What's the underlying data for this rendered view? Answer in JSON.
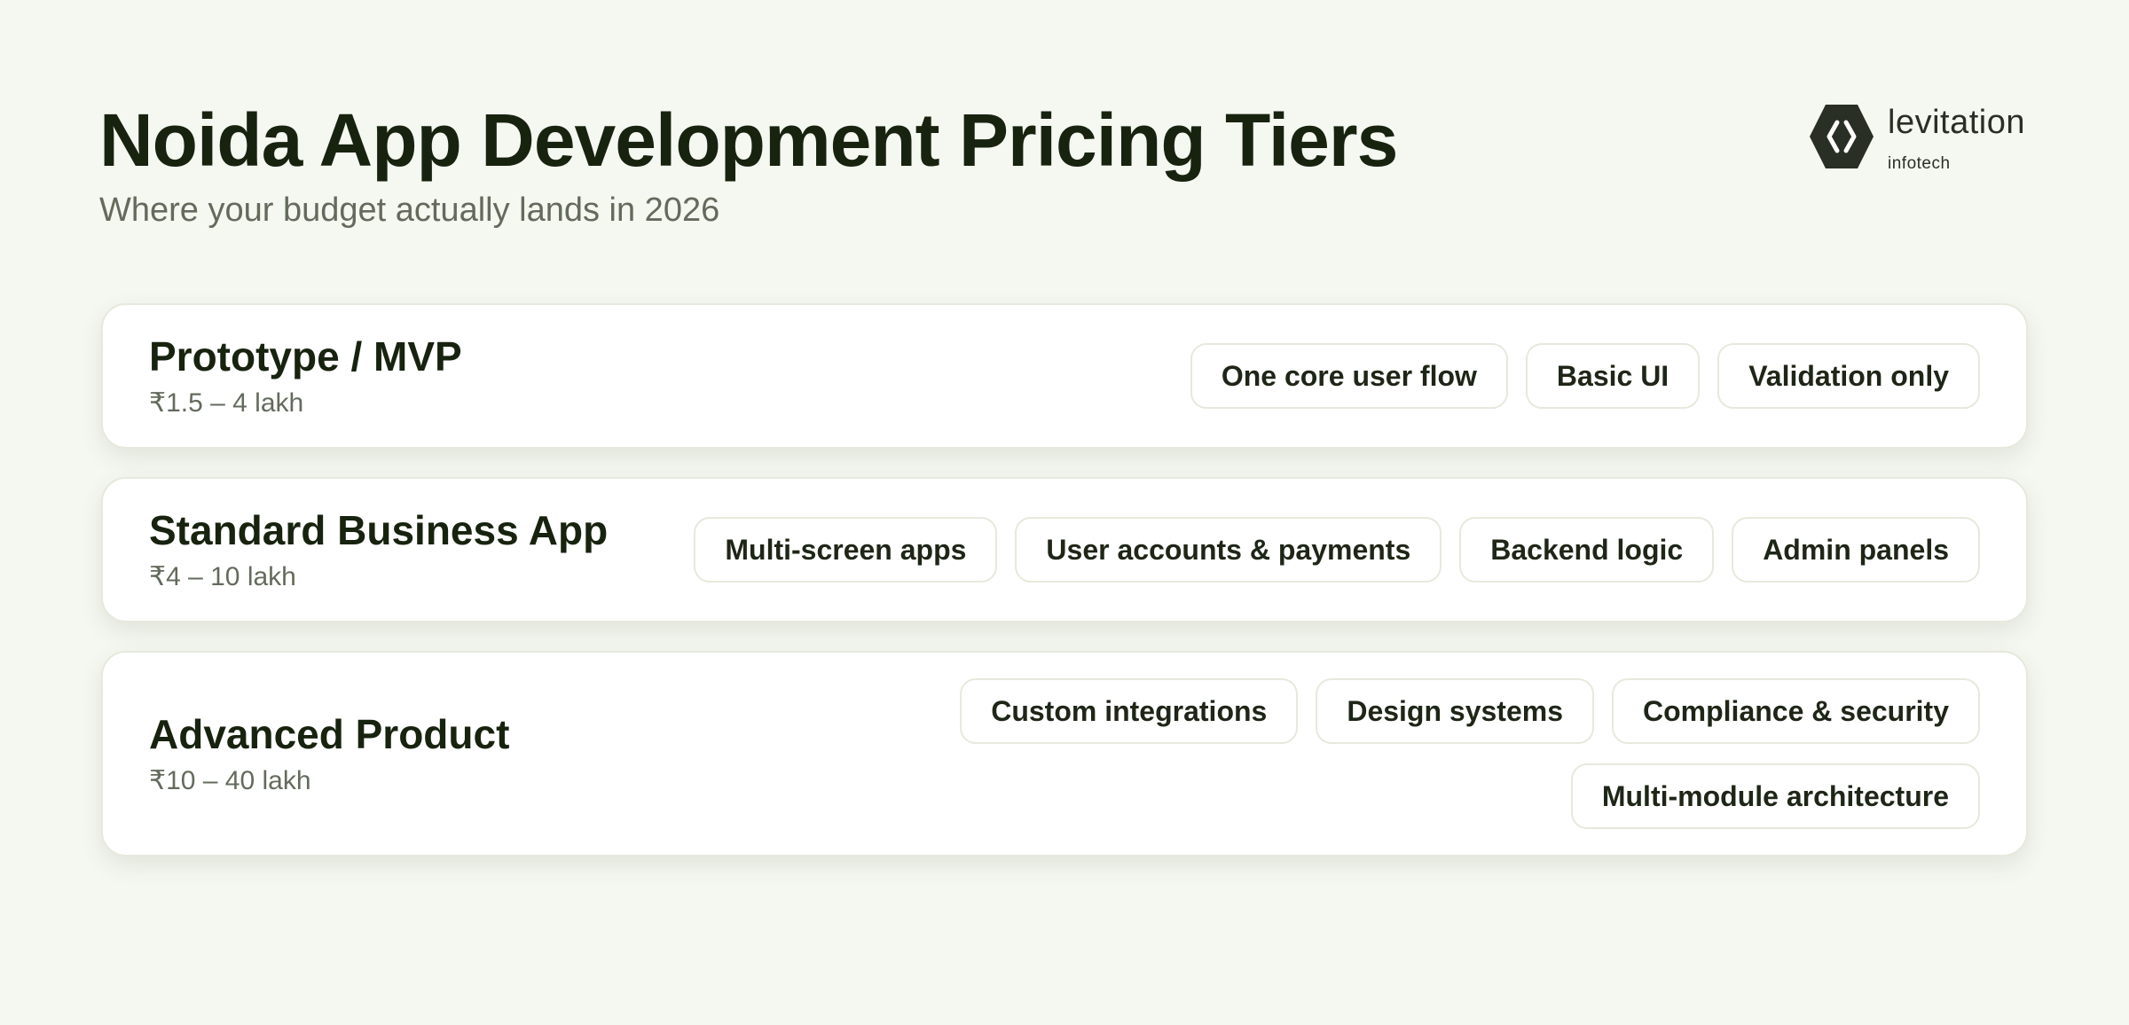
{
  "header": {
    "title": "Noida App Development Pricing Tiers",
    "subtitle": "Where your budget actually lands in 2026"
  },
  "brand": {
    "name": "levitation",
    "sub": "infotech",
    "icon": "hexagon-code-icon",
    "color": "#2a2f26"
  },
  "tiers": [
    {
      "name": "Prototype / MVP",
      "price": "₹1.5 – 4 lakh",
      "features": [
        "One core user flow",
        "Basic UI",
        "Validation only"
      ]
    },
    {
      "name": "Standard Business App",
      "price": "₹4 – 10 lakh",
      "features": [
        "Multi-screen apps",
        "User accounts & payments",
        "Backend logic",
        "Admin panels"
      ]
    },
    {
      "name": "Advanced Product",
      "price": "₹10 – 40 lakh",
      "features": [
        "Custom integrations",
        "Design systems",
        "Compliance & security",
        "Multi-module architecture"
      ]
    }
  ],
  "colors": {
    "background": "#f5f7f1",
    "card": "#ffffff",
    "title": "#18230f",
    "muted": "#636b5c"
  }
}
